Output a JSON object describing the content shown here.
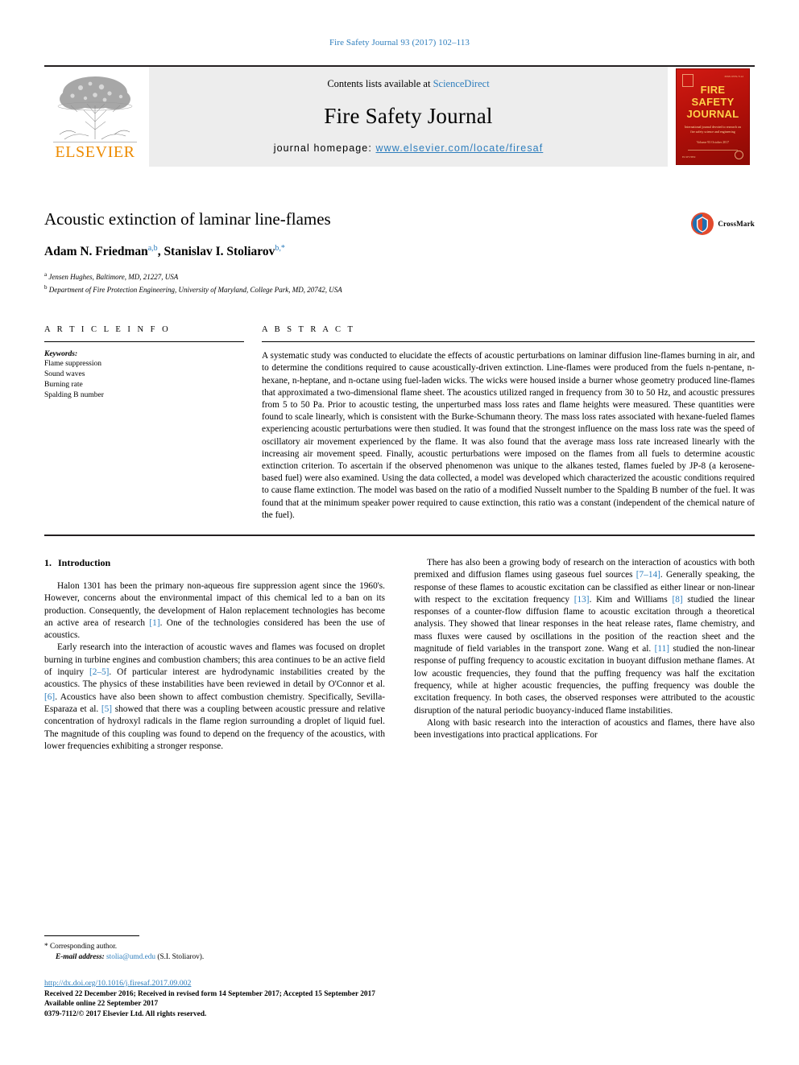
{
  "running_head": "Fire Safety Journal 93 (2017) 102–113",
  "masthead": {
    "contents_prefix": "Contents lists available at ",
    "contents_link": "ScienceDirect",
    "journal_name": "Fire Safety Journal",
    "homepage_prefix": "journal homepage: ",
    "homepage_url": "www.elsevier.com/locate/firesaf",
    "publisher": "ELSEVIER",
    "cover": {
      "line1": "FIRE",
      "line2": "SAFETY",
      "line3": "JOURNAL",
      "subtitle": "International journal devoted to research on fire safety science and engineering",
      "mid": "Volume 93\nOctober 2017",
      "footer": "ELSEVIER",
      "issue": "ISSN 0379-7112"
    }
  },
  "article": {
    "title": "Acoustic extinction of laminar line-flames",
    "authors": [
      {
        "name": "Adam N. Friedman",
        "marks": "a,b"
      },
      {
        "name": "Stanislav I. Stoliarov",
        "marks": "b,*"
      }
    ],
    "affiliations": [
      {
        "mark": "a",
        "text": "Jensen Hughes, Baltimore, MD, 21227, USA"
      },
      {
        "mark": "b",
        "text": "Department of Fire Protection Engineering, University of Maryland, College Park, MD, 20742, USA"
      }
    ],
    "crossmark_label": "CrossMark"
  },
  "article_info": {
    "heading": "A R T I C L E   I N F O",
    "keywords_label": "Keywords:",
    "keywords": [
      "Flame suppression",
      "Sound waves",
      "Burning rate",
      "Spalding B number"
    ]
  },
  "abstract": {
    "heading": "A B S T R A C T",
    "text": "A systematic study was conducted to elucidate the effects of acoustic perturbations on laminar diffusion line-flames burning in air, and to determine the conditions required to cause acoustically-driven extinction. Line-flames were produced from the fuels n-pentane, n-hexane, n-heptane, and n-octane using fuel-laden wicks. The wicks were housed inside a burner whose geometry produced line-flames that approximated a two-dimensional flame sheet. The acoustics utilized ranged in frequency from 30 to 50 Hz, and acoustic pressures from 5 to 50 Pa. Prior to acoustic testing, the unperturbed mass loss rates and flame heights were measured. These quantities were found to scale linearly, which is consistent with the Burke-Schumann theory. The mass loss rates associated with hexane-fueled flames experiencing acoustic perturbations were then studied. It was found that the strongest influence on the mass loss rate was the speed of oscillatory air movement experienced by the flame. It was also found that the average mass loss rate increased linearly with the increasing air movement speed. Finally, acoustic perturbations were imposed on the flames from all fuels to determine acoustic extinction criterion. To ascertain if the observed phenomenon was unique to the alkanes tested, flames fueled by JP-8 (a kerosene-based fuel) were also examined. Using the data collected, a model was developed which characterized the acoustic conditions required to cause flame extinction. The model was based on the ratio of a modified Nusselt number to the Spalding B number of the fuel. It was found that at the minimum speaker power required to cause extinction, this ratio was a constant (independent of the chemical nature of the fuel)."
  },
  "body": {
    "section_number": "1.",
    "section_title": "Introduction",
    "left_paragraphs": [
      "Halon 1301 has been the primary non-aqueous fire suppression agent since the 1960's. However, concerns about the environmental impact of this chemical led to a ban on its production. Consequently, the development of Halon replacement technologies has become an active area of research [1]. One of the technologies considered has been the use of acoustics.",
      "Early research into the interaction of acoustic waves and flames was focused on droplet burning in turbine engines and combustion chambers; this area continues to be an active field of inquiry [2–5]. Of particular interest are hydrodynamic instabilities created by the acoustics. The physics of these instabilities have been reviewed in detail by O'Connor et al. [6]. Acoustics have also been shown to affect combustion chemistry. Specifically, Sevilla-Esparaza et al. [5] showed that there was a coupling between acoustic pressure and relative concentration of hydroxyl radicals in the flame region surrounding a droplet of liquid fuel. The magnitude of this coupling was found to depend on the frequency of the acoustics, with lower frequencies exhibiting a stronger response."
    ],
    "right_paragraphs": [
      "There has also been a growing body of research on the interaction of acoustics with both premixed and diffusion flames using gaseous fuel sources [7–14]. Generally speaking, the response of these flames to acoustic excitation can be classified as either linear or non-linear with respect to the excitation frequency [13]. Kim and Williams [8] studied the linear responses of a counter-flow diffusion flame to acoustic excitation through a theoretical analysis. They showed that linear responses in the heat release rates, flame chemistry, and mass fluxes were caused by oscillations in the position of the reaction sheet and the magnitude of field variables in the transport zone. Wang et al. [11] studied the non-linear response of puffing frequency to acoustic excitation in buoyant diffusion methane flames. At low acoustic frequencies, they found that the puffing frequency was half the excitation frequency, while at higher acoustic frequencies, the puffing frequency was double the excitation frequency. In both cases, the observed responses were attributed to the acoustic disruption of the natural periodic buoyancy-induced flame instabilities.",
      "Along with basic research into the interaction of acoustics and flames, there have also been investigations into practical applications. For"
    ]
  },
  "footnotes": {
    "corresponding": "* Corresponding author.",
    "email_label": "E-mail address:",
    "email": "stolia@umd.edu",
    "email_suffix": "(S.I. Stoliarov).",
    "doi": "http://dx.doi.org/10.1016/j.firesaf.2017.09.002",
    "received": "Received 22 December 2016; Received in revised form 14 September 2017; Accepted 15 September 2017",
    "available": "Available online 22 September 2017",
    "copyright": "0379-7112/© 2017 Elsevier Ltd. All rights reserved."
  },
  "colors": {
    "link_blue": "#2e7ebd",
    "elsevier_orange": "#ed8b00",
    "cover_red": "#b41009",
    "rule_black": "#231f20"
  }
}
